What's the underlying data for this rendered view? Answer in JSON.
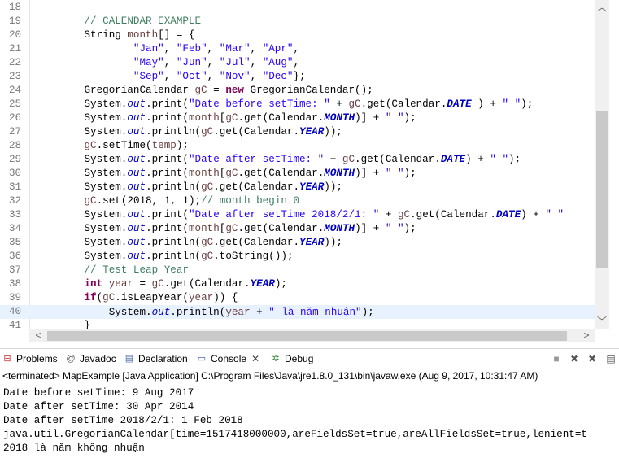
{
  "editor": {
    "lines": [
      {
        "n": "18",
        "tokens": []
      },
      {
        "n": "19",
        "tokens": [
          [
            "c-com",
            "        // CALENDAR EXAMPLE"
          ]
        ]
      },
      {
        "n": "20",
        "tokens": [
          [
            "",
            "        String "
          ],
          [
            "c-var",
            "month"
          ],
          [
            "",
            "[] = {"
          ]
        ]
      },
      {
        "n": "21",
        "tokens": [
          [
            "",
            "                "
          ],
          [
            "c-str",
            "\"Jan\""
          ],
          [
            "",
            ", "
          ],
          [
            "c-str",
            "\"Feb\""
          ],
          [
            "",
            ", "
          ],
          [
            "c-str",
            "\"Mar\""
          ],
          [
            "",
            ", "
          ],
          [
            "c-str",
            "\"Apr\""
          ],
          [
            "",
            ","
          ]
        ]
      },
      {
        "n": "22",
        "tokens": [
          [
            "",
            "                "
          ],
          [
            "c-str",
            "\"May\""
          ],
          [
            "",
            ", "
          ],
          [
            "c-str",
            "\"Jun\""
          ],
          [
            "",
            ", "
          ],
          [
            "c-str",
            "\"Jul\""
          ],
          [
            "",
            ", "
          ],
          [
            "c-str",
            "\"Aug\""
          ],
          [
            "",
            ","
          ]
        ]
      },
      {
        "n": "23",
        "tokens": [
          [
            "",
            "                "
          ],
          [
            "c-str",
            "\"Sep\""
          ],
          [
            "",
            ", "
          ],
          [
            "c-str",
            "\"Oct\""
          ],
          [
            "",
            ", "
          ],
          [
            "c-str",
            "\"Nov\""
          ],
          [
            "",
            ", "
          ],
          [
            "c-str",
            "\"Dec\""
          ],
          [
            "",
            "};"
          ]
        ]
      },
      {
        "n": "24",
        "tokens": [
          [
            "",
            "        GregorianCalendar "
          ],
          [
            "c-var",
            "gC"
          ],
          [
            "",
            " = "
          ],
          [
            "c-kw",
            "new"
          ],
          [
            "",
            " GregorianCalendar();"
          ]
        ]
      },
      {
        "n": "25",
        "tokens": [
          [
            "",
            "        System."
          ],
          [
            "c-sfld",
            "out"
          ],
          [
            "",
            ".print("
          ],
          [
            "c-str",
            "\"Date before setTime: \""
          ],
          [
            "",
            " + "
          ],
          [
            "c-var",
            "gC"
          ],
          [
            "",
            ".get(Calendar."
          ],
          [
            "c-fld",
            "DATE"
          ],
          [
            "",
            " ) + "
          ],
          [
            "c-str",
            "\" \""
          ],
          [
            "",
            ");"
          ]
        ]
      },
      {
        "n": "26",
        "tokens": [
          [
            "",
            "        System."
          ],
          [
            "c-sfld",
            "out"
          ],
          [
            "",
            ".print("
          ],
          [
            "c-var",
            "month"
          ],
          [
            "",
            "["
          ],
          [
            "c-var",
            "gC"
          ],
          [
            "",
            ".get(Calendar."
          ],
          [
            "c-fld",
            "MONTH"
          ],
          [
            "",
            ")] + "
          ],
          [
            "c-str",
            "\" \""
          ],
          [
            "",
            ");"
          ]
        ]
      },
      {
        "n": "27",
        "tokens": [
          [
            "",
            "        System."
          ],
          [
            "c-sfld",
            "out"
          ],
          [
            "",
            ".println("
          ],
          [
            "c-var",
            "gC"
          ],
          [
            "",
            ".get(Calendar."
          ],
          [
            "c-fld",
            "YEAR"
          ],
          [
            "",
            "));"
          ]
        ]
      },
      {
        "n": "28",
        "tokens": [
          [
            "",
            "        "
          ],
          [
            "c-var",
            "gC"
          ],
          [
            "",
            ".setTime("
          ],
          [
            "c-var",
            "temp"
          ],
          [
            "",
            ");"
          ]
        ]
      },
      {
        "n": "29",
        "tokens": [
          [
            "",
            "        System."
          ],
          [
            "c-sfld",
            "out"
          ],
          [
            "",
            ".print("
          ],
          [
            "c-str",
            "\"Date after setTime: \""
          ],
          [
            "",
            " + "
          ],
          [
            "c-var",
            "gC"
          ],
          [
            "",
            ".get(Calendar."
          ],
          [
            "c-fld",
            "DATE"
          ],
          [
            "",
            ") + "
          ],
          [
            "c-str",
            "\" \""
          ],
          [
            "",
            ");"
          ]
        ]
      },
      {
        "n": "30",
        "tokens": [
          [
            "",
            "        System."
          ],
          [
            "c-sfld",
            "out"
          ],
          [
            "",
            ".print("
          ],
          [
            "c-var",
            "month"
          ],
          [
            "",
            "["
          ],
          [
            "c-var",
            "gC"
          ],
          [
            "",
            ".get(Calendar."
          ],
          [
            "c-fld",
            "MONTH"
          ],
          [
            "",
            ")] + "
          ],
          [
            "c-str",
            "\" \""
          ],
          [
            "",
            ");"
          ]
        ]
      },
      {
        "n": "31",
        "tokens": [
          [
            "",
            "        System."
          ],
          [
            "c-sfld",
            "out"
          ],
          [
            "",
            ".println("
          ],
          [
            "c-var",
            "gC"
          ],
          [
            "",
            ".get(Calendar."
          ],
          [
            "c-fld",
            "YEAR"
          ],
          [
            "",
            "));"
          ]
        ]
      },
      {
        "n": "32",
        "tokens": [
          [
            "",
            "        "
          ],
          [
            "c-var",
            "gC"
          ],
          [
            "",
            ".set(2018, 1, 1);"
          ],
          [
            "c-com",
            "// month begin 0"
          ]
        ]
      },
      {
        "n": "33",
        "tokens": [
          [
            "",
            "        System."
          ],
          [
            "c-sfld",
            "out"
          ],
          [
            "",
            ".print("
          ],
          [
            "c-str",
            "\"Date after setTime 2018/2/1: \""
          ],
          [
            "",
            " + "
          ],
          [
            "c-var",
            "gC"
          ],
          [
            "",
            ".get(Calendar."
          ],
          [
            "c-fld",
            "DATE"
          ],
          [
            "",
            ") + "
          ],
          [
            "c-str",
            "\" \""
          ]
        ]
      },
      {
        "n": "34",
        "tokens": [
          [
            "",
            "        System."
          ],
          [
            "c-sfld",
            "out"
          ],
          [
            "",
            ".print("
          ],
          [
            "c-var",
            "month"
          ],
          [
            "",
            "["
          ],
          [
            "c-var",
            "gC"
          ],
          [
            "",
            ".get(Calendar."
          ],
          [
            "c-fld",
            "MONTH"
          ],
          [
            "",
            ")] + "
          ],
          [
            "c-str",
            "\" \""
          ],
          [
            "",
            ");"
          ]
        ]
      },
      {
        "n": "35",
        "tokens": [
          [
            "",
            "        System."
          ],
          [
            "c-sfld",
            "out"
          ],
          [
            "",
            ".println("
          ],
          [
            "c-var",
            "gC"
          ],
          [
            "",
            ".get(Calendar."
          ],
          [
            "c-fld",
            "YEAR"
          ],
          [
            "",
            "));"
          ]
        ]
      },
      {
        "n": "36",
        "tokens": [
          [
            "",
            "        System."
          ],
          [
            "c-sfld",
            "out"
          ],
          [
            "",
            ".println("
          ],
          [
            "c-var",
            "gC"
          ],
          [
            "",
            ".toString());"
          ]
        ]
      },
      {
        "n": "37",
        "tokens": [
          [
            "c-com",
            "        // Test Leap Year"
          ]
        ]
      },
      {
        "n": "38",
        "tokens": [
          [
            "",
            "        "
          ],
          [
            "c-kw",
            "int"
          ],
          [
            "",
            ""
          ],
          [
            "",
            " "
          ],
          [
            "c-var",
            "year"
          ],
          [
            "",
            " = "
          ],
          [
            "c-var",
            "gC"
          ],
          [
            "",
            ".get(Calendar."
          ],
          [
            "c-fld",
            "YEAR"
          ],
          [
            "",
            ");"
          ]
        ]
      },
      {
        "n": "39",
        "tokens": [
          [
            "",
            "        "
          ],
          [
            "c-kw",
            "if"
          ],
          [
            "",
            "("
          ],
          [
            "c-var",
            "gC"
          ],
          [
            "",
            ".isLeapYear("
          ],
          [
            "c-var",
            "year"
          ],
          [
            "",
            ")) {"
          ]
        ]
      },
      {
        "n": "40",
        "current": true,
        "tokens": [
          [
            "",
            "            System."
          ],
          [
            "c-sfld",
            "out"
          ],
          [
            "",
            ".println("
          ],
          [
            "c-var",
            "year"
          ],
          [
            "",
            " + "
          ],
          [
            "c-str",
            "\" "
          ],
          [
            "caret",
            ""
          ],
          [
            "c-str",
            "là năm nhuận\""
          ],
          [
            "",
            ");"
          ]
        ]
      },
      {
        "n": "41",
        "tokens": [
          [
            "",
            "        }"
          ]
        ]
      }
    ]
  },
  "tabs": [
    {
      "label": "Problems",
      "icon": "problems-icon",
      "glyph": "⊟",
      "color": "#c03030"
    },
    {
      "label": "Javadoc",
      "icon": "javadoc-icon",
      "glyph": "@",
      "color": "#555555"
    },
    {
      "label": "Declaration",
      "icon": "declaration-icon",
      "glyph": "▤",
      "color": "#4b6fa8"
    },
    {
      "label": "Console",
      "icon": "console-icon",
      "glyph": "▭",
      "color": "#2a5599",
      "active": true,
      "close": "✕"
    },
    {
      "label": "Debug",
      "icon": "debug-icon",
      "glyph": "✲",
      "color": "#3a8a3a"
    }
  ],
  "console": {
    "header": "<terminated> MapExample [Java Application] C:\\Program Files\\Java\\jre1.8.0_131\\bin\\javaw.exe (Aug 9, 2017, 10:31:47 AM)",
    "output": [
      "Date before setTime: 9 Aug 2017",
      "Date after setTime: 30 Apr 2014",
      "Date after setTime 2018/2/1: 1 Feb 2018",
      "java.util.GregorianCalendar[time=1517418000000,areFieldsSet=true,areAllFieldsSet=true,lenient=t",
      "2018 là năm không nhuận"
    ]
  }
}
